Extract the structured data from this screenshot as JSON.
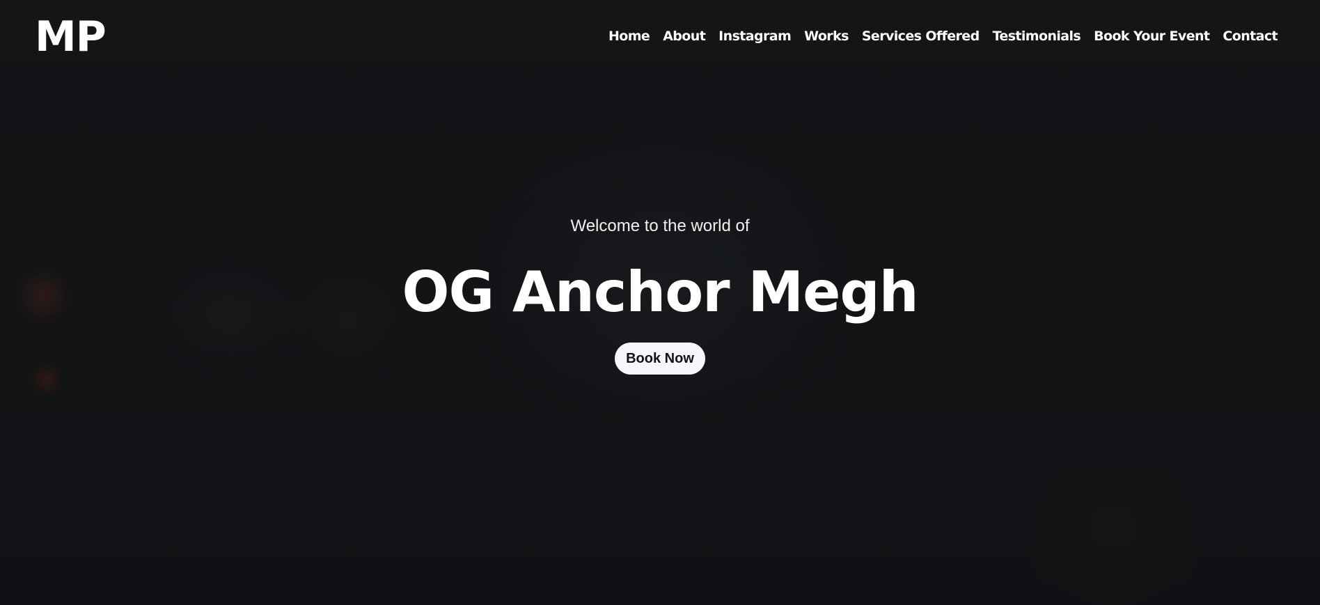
{
  "header": {
    "logo_text": "MP"
  },
  "nav": {
    "items": [
      {
        "label": "Home"
      },
      {
        "label": "About"
      },
      {
        "label": "Instagram"
      },
      {
        "label": "Works"
      },
      {
        "label": "Services Offered"
      },
      {
        "label": "Testimonials"
      },
      {
        "label": "Book Your Event"
      },
      {
        "label": "Contact"
      }
    ]
  },
  "hero": {
    "subtitle": "Welcome to the world of",
    "title": "OG Anchor Megh",
    "cta_label": "Book Now"
  },
  "colors": {
    "background": "#141618",
    "text": "#ffffff",
    "button_bg": "#f7f7fb",
    "button_text": "#111111"
  }
}
